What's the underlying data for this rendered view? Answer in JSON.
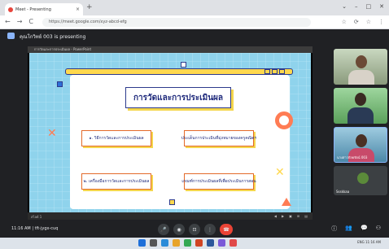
{
  "browser": {
    "tab_title": "Meet - Presenting",
    "tab_close": "×",
    "new_tab": "+",
    "window_controls": [
      "⌄",
      "–",
      "□",
      "✕"
    ],
    "nav": [
      "←",
      "→",
      "C"
    ],
    "url": "https://meet.google.com/xyz-abcd-efg",
    "toolbar_icons": [
      "☆",
      "⟳",
      "☆",
      "⋮"
    ]
  },
  "meet": {
    "presenting_text": "คุณโกวิทย์ 003 is presenting",
    "slide_titlebar": "การวัดและการประเมินผล - PowerPoint",
    "slide_bottom_label": "สไลด์ 1",
    "slide_bottom_controls": [
      "◀",
      "▶",
      "▣",
      "⊞",
      "▤"
    ],
    "time_meeting": "11:16 AM  |  tft-jygx-cuq",
    "controls": [
      "🎤",
      "◉",
      "⊡",
      "⋮",
      "☎"
    ],
    "right_controls": [
      "ⓘ",
      "👥",
      "💬",
      "⚇"
    ],
    "participants": [
      {
        "name": ""
      },
      {
        "name": ""
      },
      {
        "name": "นางสาวกัลยรัตน์ 003"
      },
      {
        "name": "Ssskkaa"
      }
    ]
  },
  "slide": {
    "title": "การวัดและการประเมินผล",
    "items": [
      "๑. วิธีการวัดและการประเมินผล",
      "ประเด็นการประเมินที่มุ่งหมายของครูคณิตฯ",
      "๒. เครื่องมือการวัดและการประเมินผล",
      "เกณฑ์การประเมินผลที่เพื่อประเมินการสอน"
    ]
  },
  "taskbar": {
    "tray_text": "ENG  11:16 AM"
  },
  "colors": {
    "slide_bg": "#8fd3ec",
    "accent_yellow": "#ffd84d",
    "accent_orange": "#ff7c54",
    "title_blue": "#1f2a7c",
    "end_call": "#ea4335"
  }
}
